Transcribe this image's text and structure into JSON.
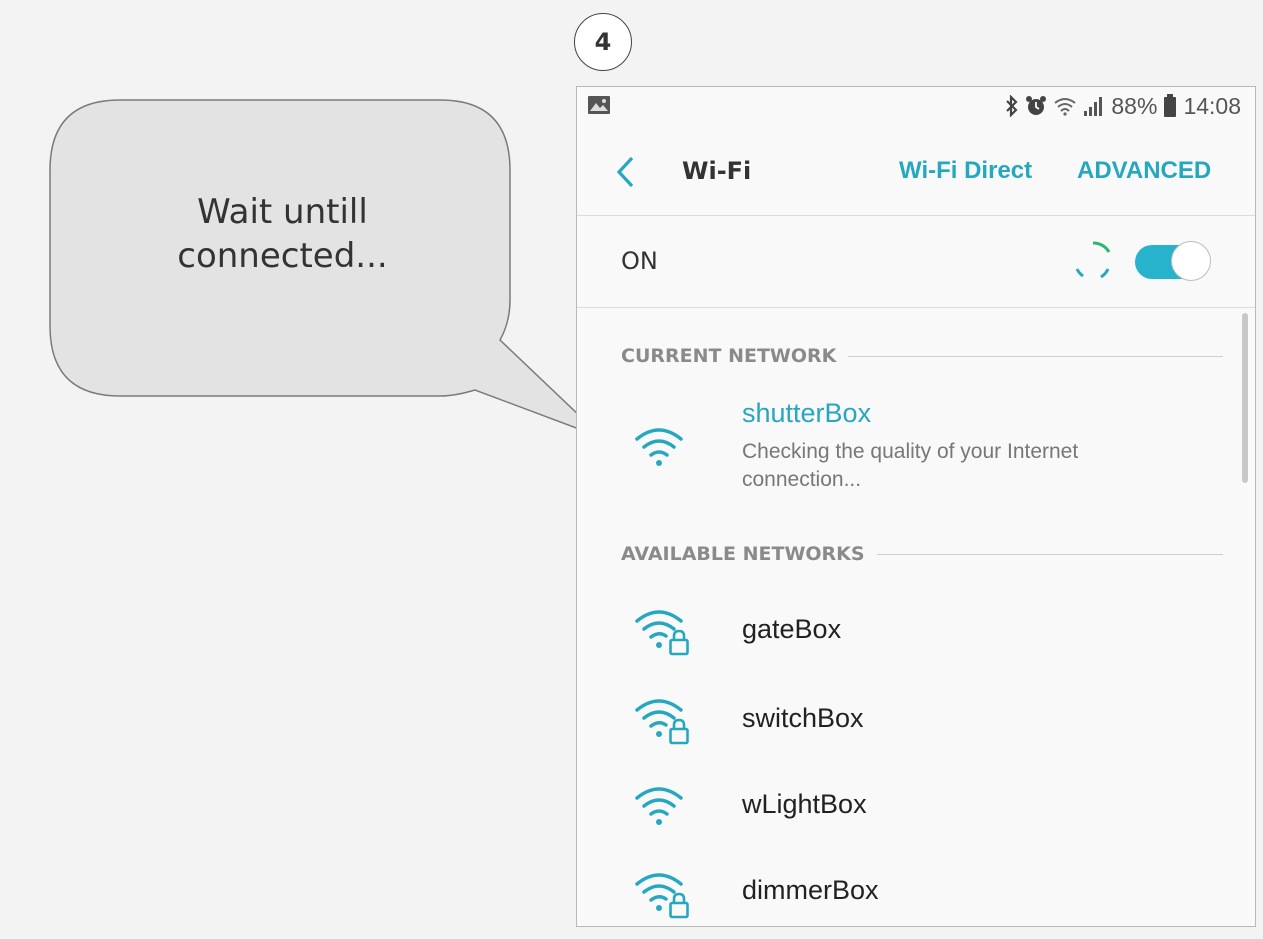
{
  "step": {
    "number": "4"
  },
  "callout": {
    "lines": [
      "Wait untill",
      "connected..."
    ]
  },
  "status_bar": {
    "left_icon": "image-icon",
    "battery_percent": "88%",
    "time": "14:08",
    "icons": [
      "bluetooth-icon",
      "alarm-icon",
      "wifi-icon",
      "signal-icon",
      "battery-icon"
    ]
  },
  "appbar": {
    "title": "Wi-Fi",
    "wifi_direct": "Wi-Fi Direct",
    "advanced": "ADVANCED"
  },
  "wifi_toggle": {
    "label": "ON",
    "state": "on"
  },
  "current_network": {
    "header": "CURRENT NETWORK",
    "name": "shutterBox",
    "status": "Checking the quality of your Internet connection...",
    "secured": false
  },
  "available_networks": {
    "header": "AVAILABLE NETWORKS",
    "items": [
      {
        "name": "gateBox",
        "secured": true
      },
      {
        "name": "switchBox",
        "secured": true
      },
      {
        "name": "wLightBox",
        "secured": false
      },
      {
        "name": "dimmerBox",
        "secured": true
      }
    ]
  },
  "colors": {
    "accent": "#26a7c0",
    "toggle": "#27b3cc",
    "text": "#222222",
    "muted": "#8a8a8a"
  }
}
